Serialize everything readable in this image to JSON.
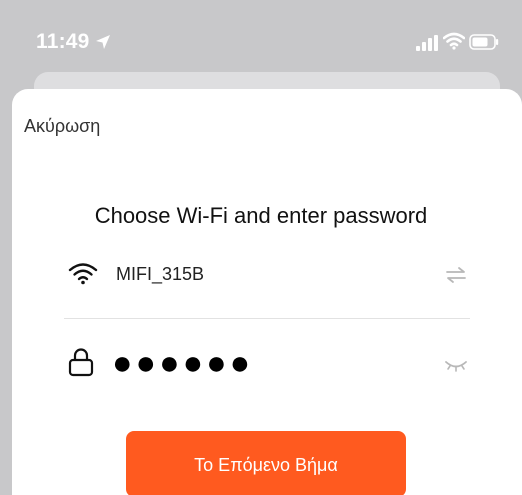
{
  "status_bar": {
    "time": "11:49",
    "icons": [
      "location-arrow-icon",
      "signal-icon",
      "wifi-icon",
      "battery-icon"
    ]
  },
  "sheet": {
    "cancel_label": "Ακύρωση",
    "title": "Choose Wi-Fi and enter password",
    "wifi": {
      "icon": "wifi-icon",
      "ssid": "MIFI_315B",
      "switch_icon": "switch-network-icon"
    },
    "password": {
      "icon": "lock-icon",
      "masked_value": "●●●●●●",
      "toggle_icon": "eye-closed-icon"
    },
    "next_button_label": "Το Επόμενο Βήμα"
  },
  "colors": {
    "accent": "#ff5a1f",
    "backdrop": "#c8c8ca",
    "sheet_background": "#ffffff"
  }
}
